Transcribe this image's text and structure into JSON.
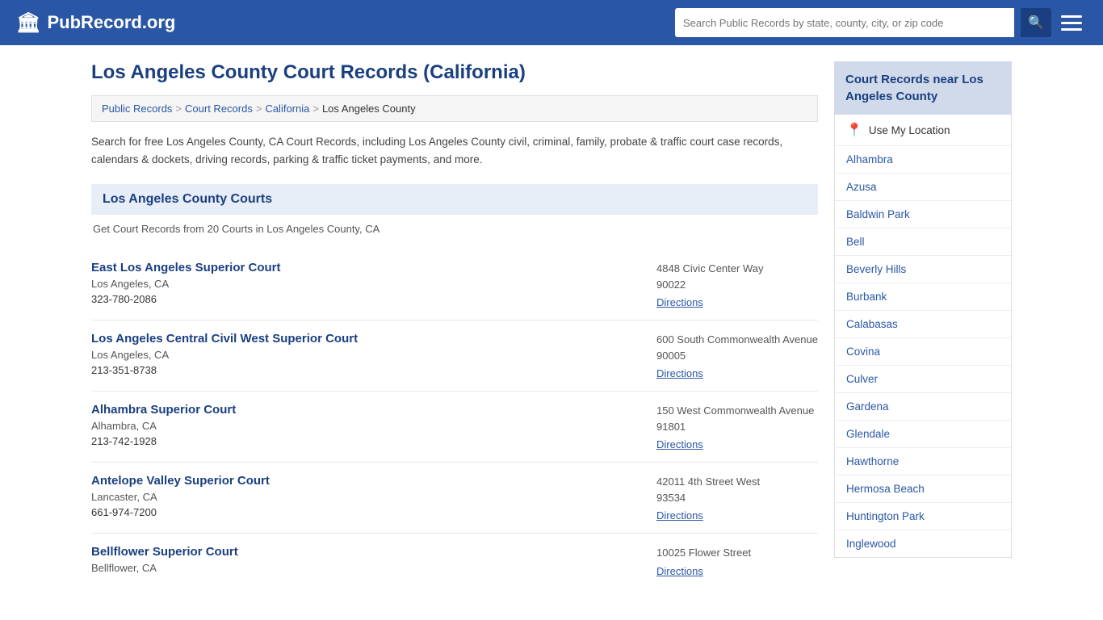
{
  "header": {
    "logo_text": "PubRecord.org",
    "search_placeholder": "Search Public Records by state, county, city, or zip code",
    "search_icon": "🔍"
  },
  "page": {
    "title": "Los Angeles County Court Records (California)"
  },
  "breadcrumb": {
    "items": [
      {
        "label": "Public Records",
        "link": true
      },
      {
        "label": "Court Records",
        "link": true
      },
      {
        "label": "California",
        "link": true
      },
      {
        "label": "Los Angeles County",
        "link": false
      }
    ]
  },
  "description": "Search for free Los Angeles County, CA Court Records, including Los Angeles County civil, criminal, family, probate & traffic court case records, calendars & dockets, driving records, parking & traffic ticket payments, and more.",
  "section": {
    "header": "Los Angeles County Courts",
    "subtext": "Get Court Records from 20 Courts in Los Angeles County, CA"
  },
  "courts": [
    {
      "name": "East Los Angeles Superior Court",
      "city": "Los Angeles, CA",
      "phone": "323-780-2086",
      "address": "4848 Civic Center Way",
      "zip": "90022",
      "directions_label": "Directions"
    },
    {
      "name": "Los Angeles Central Civil West Superior Court",
      "city": "Los Angeles, CA",
      "phone": "213-351-8738",
      "address": "600 South Commonwealth Avenue",
      "zip": "90005",
      "directions_label": "Directions"
    },
    {
      "name": "Alhambra Superior Court",
      "city": "Alhambra, CA",
      "phone": "213-742-1928",
      "address": "150 West Commonwealth Avenue",
      "zip": "91801",
      "directions_label": "Directions"
    },
    {
      "name": "Antelope Valley Superior Court",
      "city": "Lancaster, CA",
      "phone": "661-974-7200",
      "address": "42011 4th Street West",
      "zip": "93534",
      "directions_label": "Directions"
    },
    {
      "name": "Bellflower Superior Court",
      "city": "Bellflower, CA",
      "phone": "",
      "address": "10025 Flower Street",
      "zip": "",
      "directions_label": "Directions"
    }
  ],
  "sidebar": {
    "header": "Court Records near Los Angeles County",
    "use_location_label": "Use My Location",
    "nearby": [
      "Alhambra",
      "Azusa",
      "Baldwin Park",
      "Bell",
      "Beverly Hills",
      "Burbank",
      "Calabasas",
      "Covina",
      "Culver",
      "Gardena",
      "Glendale",
      "Hawthorne",
      "Hermosa Beach",
      "Huntington Park",
      "Inglewood"
    ]
  }
}
